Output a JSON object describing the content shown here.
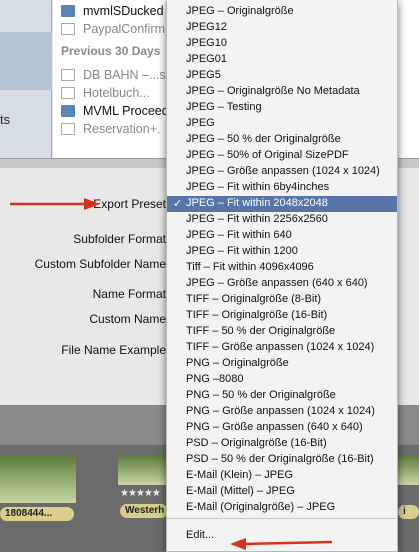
{
  "sources": {
    "left_fragment": "ts",
    "folder_rows": [
      {
        "name": "mvmlSDucked",
        "kind": "folder",
        "grey": false
      },
      {
        "name": "PaypalConfirm",
        "kind": "doc",
        "grey": true
      }
    ],
    "section_title": "Previous 30 Days",
    "recent_rows": [
      {
        "name": "DB BAHN –...s",
        "kind": "doc",
        "grey": true
      },
      {
        "name": "Hotelbuch...",
        "kind": "doc",
        "grey": true
      },
      {
        "name": "MVML Proceed",
        "kind": "folder",
        "grey": false
      },
      {
        "name": "Reservation+.",
        "kind": "doc",
        "grey": true
      }
    ]
  },
  "export_form": {
    "export_preset_label": "Export Preset",
    "subfolder_format_label": "Subfolder Format",
    "custom_subfolder_name_label": "Custom Subfolder Name",
    "name_format_label": "Name Format",
    "custom_name_label": "Custom Name",
    "file_name_example_label": "File Name Example"
  },
  "filmstrip": {
    "thumbs": [
      {
        "caption": "1808444...",
        "stars": "★★★★★"
      },
      {
        "caption": "Westerh",
        "stars": "★★★★★"
      },
      {
        "caption": "i",
        "stars": ""
      }
    ]
  },
  "menu": {
    "check_mark": "✓",
    "items": [
      "JPEG – Originalgröße",
      "JPEG12",
      "JPEG10",
      "JPEG01",
      "JPEG5",
      "JPEG – Originalgröße No Metadata",
      "JPEG – Testing",
      "JPEG",
      "JPEG – 50 % der Originalgröße",
      "JPEG – 50% of Original SizePDF",
      "JPEG – Größe anpassen (1024 x 1024)",
      "JPEG – Fit within 6by4inches",
      "JPEG – Fit within 2048x2048",
      "JPEG – Fit within 2256x2560",
      "JPEG – Fit within 640",
      "JPEG – Fit within 1200",
      "Tiff – Fit within 4096x4096",
      "JPEG – Größe anpassen (640 x 640)",
      "TIFF – Originalgröße (8-Bit)",
      "TIFF – Originalgröße (16-Bit)",
      "TIFF – 50 % der Originalgröße",
      "TIFF – Größe anpassen (1024 x 1024)",
      "PNG – Originalgröße",
      "PNG –8080",
      "PNG – 50 % der Originalgröße",
      "PNG – Größe anpassen (1024 x 1024)",
      "PNG – Größe anpassen (640 x 640)",
      "PSD – Originalgröße (16-Bit)",
      "PSD – 50 % der Originalgröße (16-Bit)",
      "E-Mail (Klein) – JPEG",
      "E-Mail (Mittel) – JPEG",
      "E-Mail (Originalgröße) – JPEG"
    ],
    "selected_index": 12,
    "edit_label": "Edit..."
  },
  "colors": {
    "selection": "#5775a8",
    "annotation_arrow": "#d8321e"
  }
}
